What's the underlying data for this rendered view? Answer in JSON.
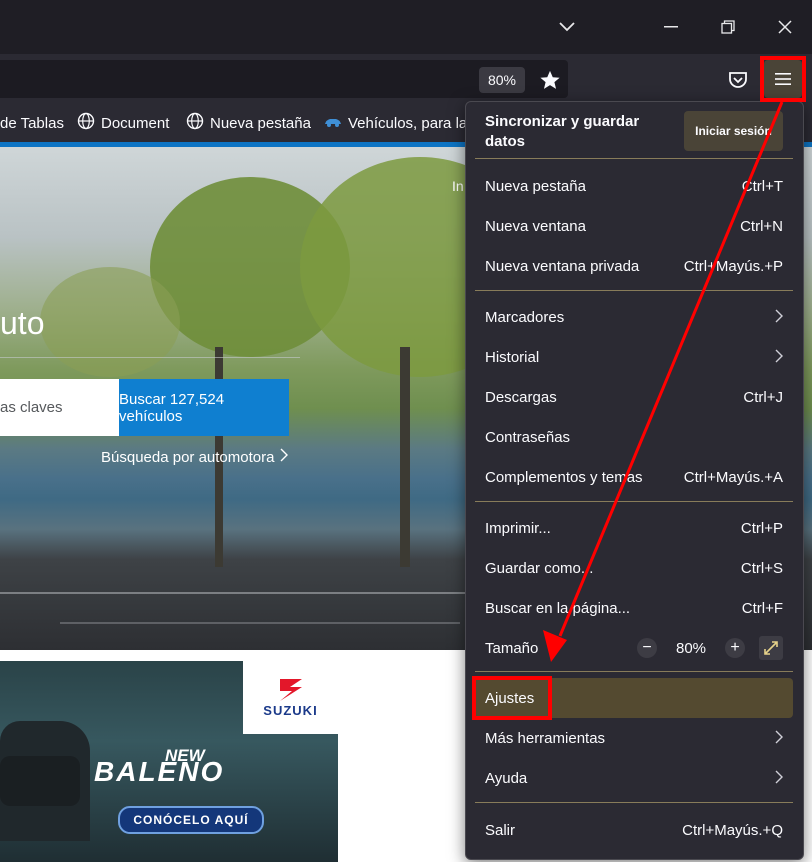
{
  "window": {
    "controls": [
      "chevron-down",
      "restore",
      "close"
    ]
  },
  "navbar": {
    "zoom_badge": "80%",
    "icons": [
      "star-icon",
      "pocket-icon",
      "hamburger-menu-icon"
    ]
  },
  "bookmarks": [
    {
      "label": "de Tablas",
      "icon": ""
    },
    {
      "label": "Document",
      "icon": "globe-icon"
    },
    {
      "label": "Nueva pestaña",
      "icon": "globe-icon"
    },
    {
      "label": "Vehículos, para la",
      "icon": "car-icon"
    }
  ],
  "page": {
    "top_link": "In",
    "hero_title": "uto",
    "search_placeholder": "as claves",
    "search_button": "Buscar 127,524 vehículos",
    "automotora_link": "Búsqueda por automotora",
    "ad": {
      "logo_text": "SUZUKI",
      "new": "NEW",
      "model": "BALENO",
      "cta": "CONÓCELO AQUÍ"
    }
  },
  "menu": {
    "sync_title": "Sincronizar y guardar datos",
    "signin_button": "Iniciar sesión",
    "items": [
      {
        "label": "Nueva pestaña",
        "shortcut": "Ctrl+T"
      },
      {
        "label": "Nueva ventana",
        "shortcut": "Ctrl+N"
      },
      {
        "label": "Nueva ventana privada",
        "shortcut": "Ctrl+Mayús.+P"
      },
      {
        "label": "Marcadores",
        "shortcut": ""
      },
      {
        "label": "Historial",
        "shortcut": ""
      },
      {
        "label": "Descargas",
        "shortcut": "Ctrl+J"
      },
      {
        "label": "Contraseñas",
        "shortcut": ""
      },
      {
        "label": "Complementos y temas",
        "shortcut": "Ctrl+Mayús.+A"
      },
      {
        "label": "Imprimir...",
        "shortcut": "Ctrl+P"
      },
      {
        "label": "Guardar como...",
        "shortcut": "Ctrl+S"
      },
      {
        "label": "Buscar en la página...",
        "shortcut": "Ctrl+F"
      },
      {
        "label": "Tamaño",
        "shortcut": ""
      },
      {
        "label": "Ajustes",
        "shortcut": ""
      },
      {
        "label": "Más herramientas",
        "shortcut": ""
      },
      {
        "label": "Ayuda",
        "shortcut": ""
      },
      {
        "label": "Salir",
        "shortcut": "Ctrl+Mayús.+Q"
      }
    ],
    "zoom": {
      "minus": "−",
      "value": "80%",
      "plus": "+"
    }
  },
  "colors": {
    "annotation": "#ff0000",
    "accent_blue": "#0f7fd0",
    "highlight": "#544a30"
  }
}
